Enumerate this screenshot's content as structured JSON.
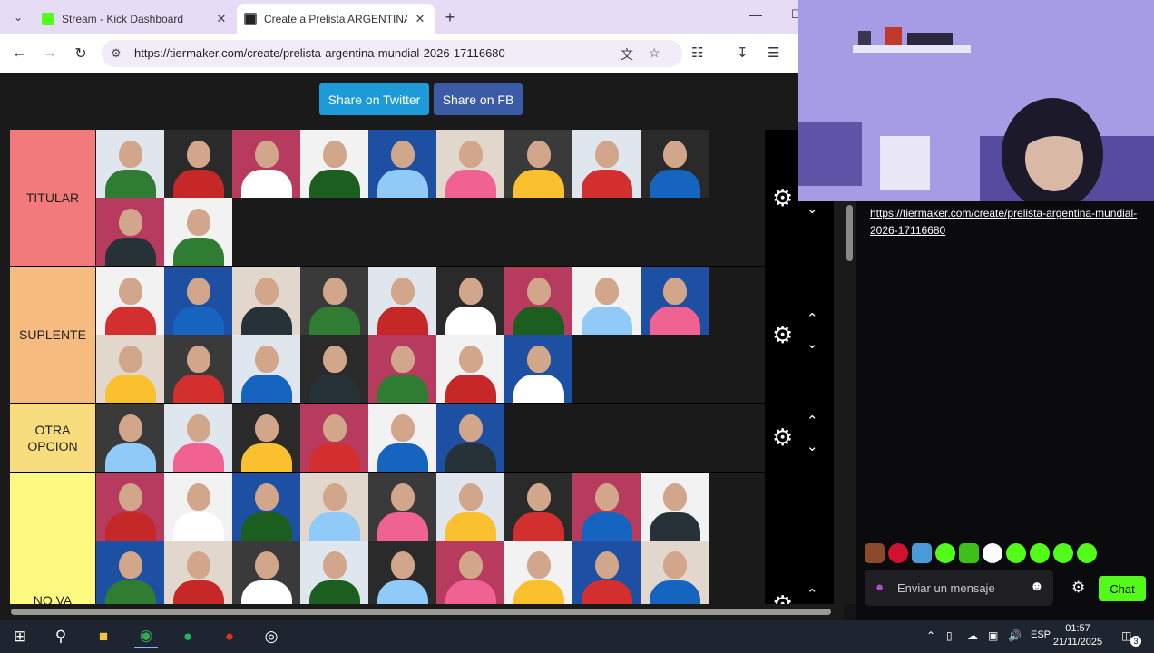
{
  "browser": {
    "tabs": [
      {
        "title": "Stream - Kick Dashboard",
        "favicon_color": "#53fc18",
        "active": false
      },
      {
        "title": "Create a Prelista ARGENTINA M",
        "favicon_color": "#222222",
        "active": true
      }
    ],
    "url": "https://tiermaker.com/create/prelista-argentina-mundial-2026-17116680"
  },
  "page": {
    "share_twitter": "Share on Twitter",
    "share_fb": "Share on FB",
    "tiers": [
      {
        "label": "TITULAR",
        "color": "#f27a7a",
        "player_count": 11
      },
      {
        "label": "SUPLENTE",
        "color": "#f6bc7f",
        "player_count": 16
      },
      {
        "label": "OTRA OPCION",
        "color": "#f8dd7f",
        "player_count": 6
      },
      {
        "label": "NO VA",
        "color": "#fdfa7f",
        "player_count": 18
      }
    ]
  },
  "chat": {
    "link": "https://tiermaker.com/create/prelista-argentina-mundial-2026-17116680",
    "input_placeholder": "Enviar un mensaje",
    "send_label": "Chat",
    "accent": "#53fc18"
  },
  "taskbar": {
    "language": "ESP",
    "time": "01:57",
    "date": "21/11/2025",
    "notifications": "3"
  }
}
